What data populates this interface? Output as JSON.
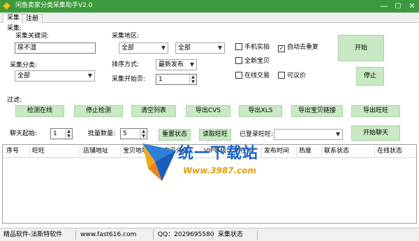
{
  "window": {
    "title": "闲鱼卖家分类采集助手V2.0",
    "min": "—",
    "max": "▢",
    "close": "✕"
  },
  "tabs": [
    {
      "label": "采集"
    },
    {
      "label": "注册"
    }
  ],
  "collect": {
    "group_label": "采集:",
    "keyword": {
      "label": "采集关键词:",
      "value": "尿不湿"
    },
    "region": {
      "label": "采集地区:",
      "province": "全部",
      "city": "全部"
    },
    "category": {
      "label": "采集分类:",
      "value": "全部"
    },
    "sort": {
      "label": "排序方式:",
      "value": "最新发布"
    },
    "start_page": {
      "label": "采集开始页:",
      "value": "1"
    },
    "checkboxes": [
      {
        "label": "手机实拍",
        "checked": false
      },
      {
        "label": "自动去重复",
        "checked": true
      },
      {
        "label": "全新宝贝",
        "checked": false
      },
      {
        "label": "在线交易",
        "checked": false
      },
      {
        "label": "可议价",
        "checked": false
      }
    ],
    "start_button": "开始",
    "stop_button": "停止"
  },
  "filter": {
    "group_label": "过滤:",
    "buttons": [
      "检测在线",
      "停止检测",
      "清空列表",
      "导出CVS",
      "导出XLS",
      "导出宝贝链接",
      "导出旺旺"
    ]
  },
  "chat": {
    "start_label": "聊天起始:",
    "start_value": "1",
    "batch_label": "批量数量:",
    "batch_value": "5",
    "reset_button": "重置状态",
    "read_button": "读取旺旺",
    "logged_label": "已登录旺旺:",
    "logged_value": "",
    "start_chat_button": "开始聊天"
  },
  "table": {
    "columns": [
      "序号",
      "旺旺",
      "店铺地址",
      "宝贝地址",
      "宝贝介绍",
      "VIP等级",
      "所在地",
      "发布时间",
      "热度",
      "联系状态",
      "在线状态"
    ]
  },
  "watermark": {
    "text": "统一下载站",
    "url": "Www.3987.com"
  },
  "status": {
    "vendor": "精品软件-法斯特软件",
    "site": "www.fast616.com",
    "qq": "QQ：2029695580",
    "state": "采集状态"
  },
  "colors": {
    "title_bar": "#3c9a3c",
    "button_green": "#c9e9c5"
  }
}
